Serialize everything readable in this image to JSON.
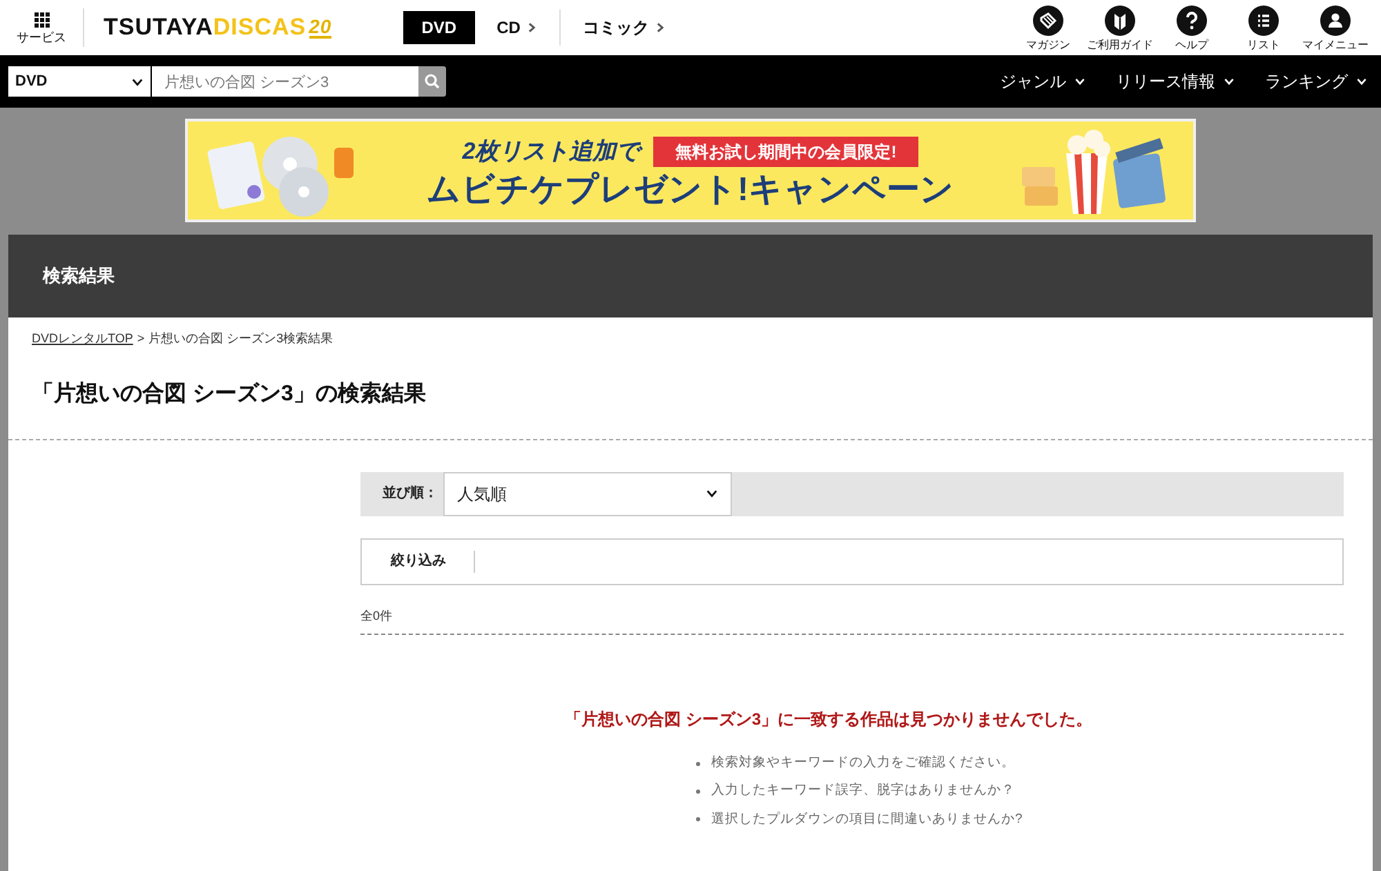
{
  "header": {
    "service_label": "サービス",
    "logo": {
      "part_1": "TSUTAYA",
      "part_2": "DISCAS",
      "badge": "20"
    },
    "tabs": [
      {
        "label": "DVD",
        "selected": true
      },
      {
        "label": "CD",
        "selected": false
      },
      {
        "label": "コミック",
        "selected": false
      }
    ],
    "icon_links": [
      {
        "kind": "magazine",
        "label": "マガジン"
      },
      {
        "kind": "guide",
        "label": "ご利用ガイド"
      },
      {
        "kind": "help",
        "label": "ヘルプ"
      },
      {
        "kind": "list",
        "label": "リスト"
      },
      {
        "kind": "user",
        "label": "マイメニュー"
      }
    ]
  },
  "search_bar": {
    "category": "DVD",
    "query": "片想いの合図 シーズン3",
    "menus": [
      "ジャンル",
      "リリース情報",
      "ランキング"
    ]
  },
  "banner": {
    "ribbon": "2枚リスト追加で",
    "tag": "無料お試し期間中の会員限定!",
    "headline": "ムビチケプレゼント!キャンペーン"
  },
  "section_title": "検索結果",
  "breadcrumb": {
    "link": "DVDレンタルTOP",
    "separator": ">",
    "current": "片想いの合図 シーズン3検索結果"
  },
  "page_title": "「片想いの合図 シーズン3」の検索結果",
  "sort": {
    "label": "並び順：",
    "value": "人気順"
  },
  "filter_label": "絞り込み",
  "count": "全0件",
  "empty": {
    "message": "「片想いの合図 シーズン3」に一致する作品は見つかりませんでした。",
    "tips": [
      "検索対象やキーワードの入力をご確認ください。",
      "入力したキーワード誤字、脱字はありませんか？",
      "選択したプルダウンの項目に間違いありませんか?"
    ]
  }
}
